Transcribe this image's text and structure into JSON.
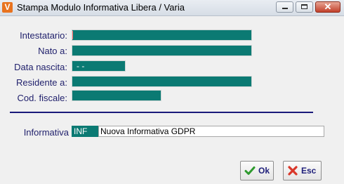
{
  "window": {
    "title": "Stampa Modulo Informativa Libera / Varia",
    "app_icon": "V",
    "close_glyph": "✕"
  },
  "form": {
    "intestatario_label": "Intestatario:",
    "nato_label": "Nato a:",
    "data_nascita_label": "Data nascita:",
    "data_nascita_value": "- -",
    "residente_label": "Residente a:",
    "cod_fiscale_label": "Cod. fiscale:",
    "informativa_label": "Informativa",
    "informativa_code": "INF",
    "informativa_desc": "Nuova Informativa GDPR"
  },
  "buttons": {
    "ok_label": "Ok",
    "esc_label": "Esc"
  },
  "colors": {
    "field_bg": "#0b7a73",
    "label_text": "#1f1f6b",
    "separator": "#1a1a7a"
  },
  "icons": {
    "ok": "check-icon",
    "esc": "cross-icon"
  }
}
